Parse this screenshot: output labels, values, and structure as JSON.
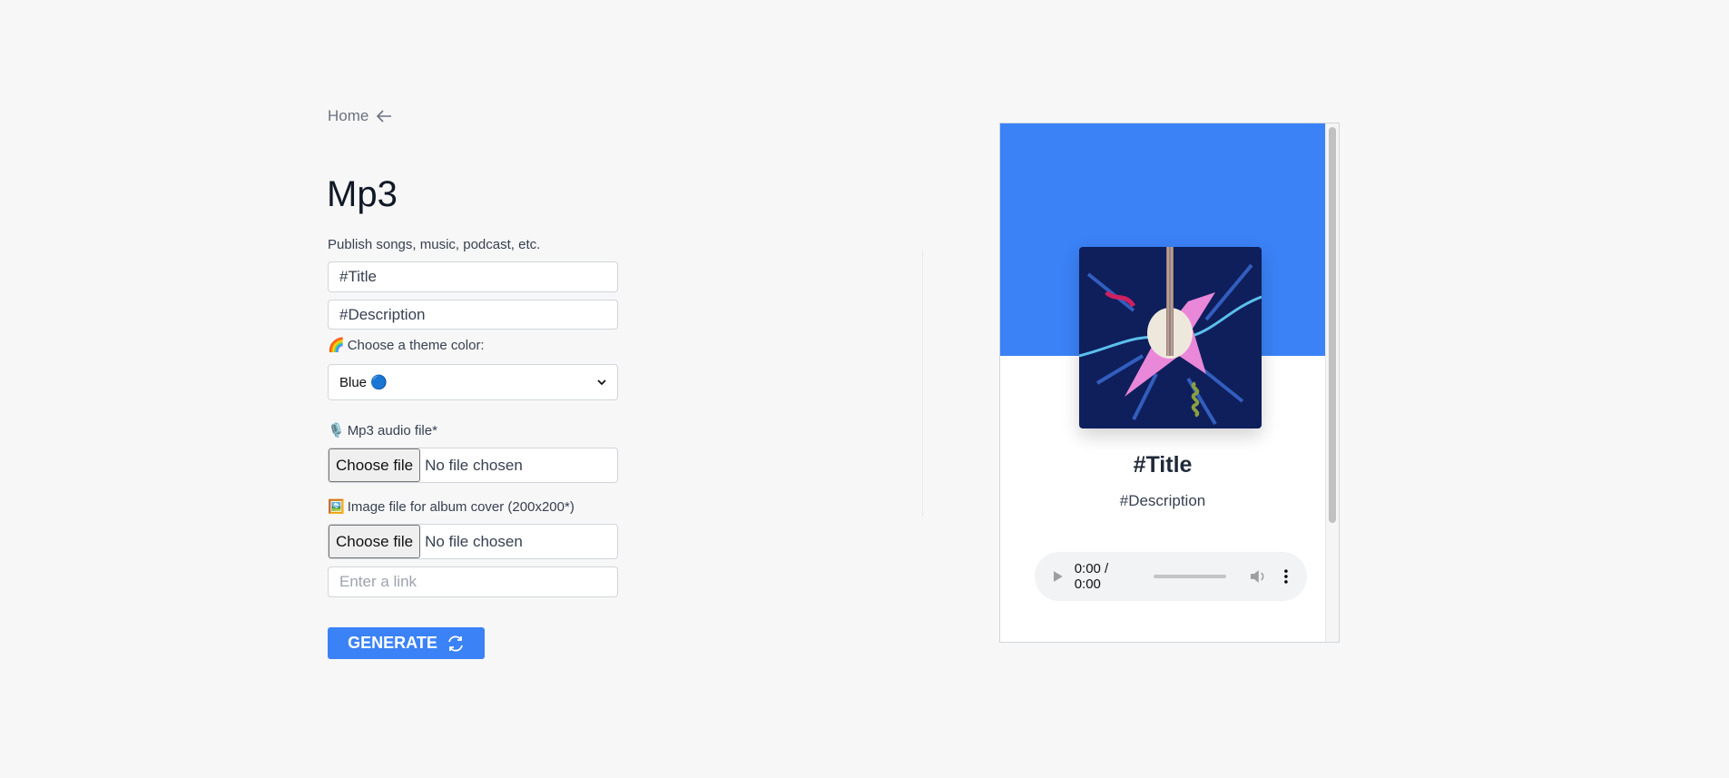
{
  "nav": {
    "home_label": "Home",
    "home_icon": "arrow-left-icon"
  },
  "page": {
    "title": "Mp3",
    "subtitle": "Publish songs, music, podcast, etc."
  },
  "form": {
    "title_value": "#Title",
    "description_value": "#Description",
    "theme_label": "Choose a theme color:",
    "theme_emoji": "🌈",
    "theme_selected": "Blue 🔵",
    "audio_label": "Mp3 audio file*",
    "audio_emoji": "🎙️",
    "audio_button": "Choose file",
    "audio_status": "No file chosen",
    "image_label": "Image file for album cover (200x200*)",
    "image_emoji": "🖼️",
    "image_button": "Choose file",
    "image_status": "No file chosen",
    "link_placeholder": "Enter a link",
    "generate_label": "GENERATE",
    "generate_icon": "refresh-icon"
  },
  "preview": {
    "title": "#Title",
    "description": "#Description",
    "time": "0:00 / 0:00",
    "accent": "#3b82f6"
  }
}
